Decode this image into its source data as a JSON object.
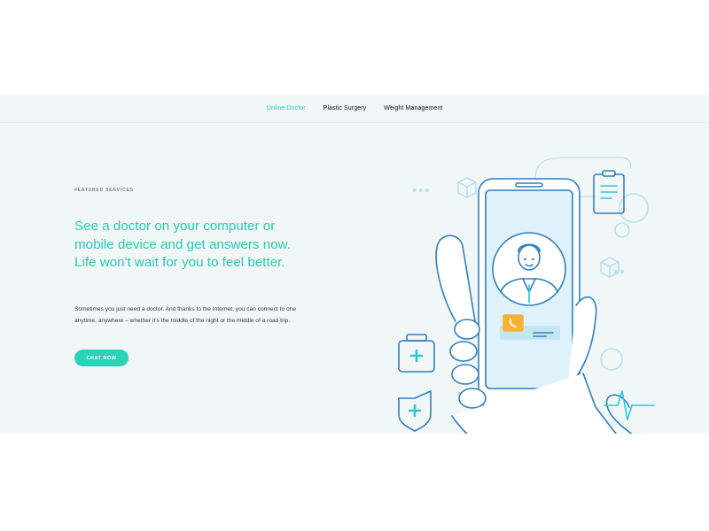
{
  "nav": {
    "tabs": [
      {
        "label": "Online Doctor",
        "active": true
      },
      {
        "label": "Plastic Surgery",
        "active": false
      },
      {
        "label": "Weight Management",
        "active": false
      }
    ]
  },
  "hero": {
    "eyebrow": "FEATURED SERVICES",
    "headline": "See a doctor on your computer or mobile device and get answers now. Life won't wait for you to feel better.",
    "body": "Sometimes you just need a doctor. And thanks to the Internet, you can connect to one anytime, anywhere – whether it's the middle of the night or the middle of a road trip.",
    "cta_label": "CHAT NOW"
  },
  "colors": {
    "accent": "#2bc9b0",
    "button": "#2ad3b8",
    "panel_bg": "#f1f7f6",
    "illustration_line": "#2f7fc2",
    "sleeve": "#2f7fc2",
    "chat_bubble": "#f4b237"
  },
  "illustration": {
    "icons": [
      "medical-kit-icon",
      "shield-cross-icon",
      "clipboard-icon",
      "heartbeat-icon",
      "gear-icon",
      "cube-icon",
      "chat-bubble-icon",
      "phone-call-icon",
      "doctor-avatar"
    ]
  }
}
